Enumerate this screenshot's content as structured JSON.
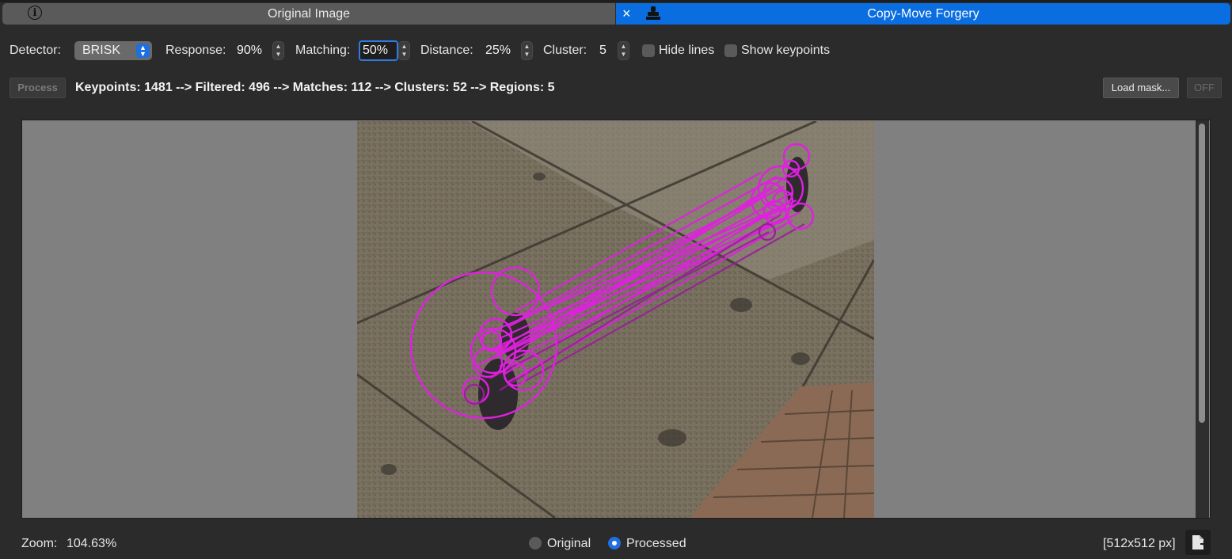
{
  "tabs": [
    {
      "label": "Original Image",
      "icon": "info-icon",
      "active": false
    },
    {
      "label": "Copy-Move Forgery",
      "icon": "stamp-icon",
      "active": true,
      "close_label": "×"
    }
  ],
  "controls": {
    "detector_label": "Detector:",
    "detector_value": "BRISK",
    "response_label": "Response:",
    "response_value": "90%",
    "matching_label": "Matching:",
    "matching_value": "50%",
    "distance_label": "Distance:",
    "distance_value": "25%",
    "cluster_label": "Cluster:",
    "cluster_value": "5",
    "hide_lines_label": "Hide lines",
    "hide_lines_checked": false,
    "show_keypoints_label": "Show keypoints",
    "show_keypoints_checked": false
  },
  "actions": {
    "process_label": "Process",
    "status_text": "Keypoints: 1481 --> Filtered: 496 --> Matches: 112 --> Clusters: 52 --> Regions: 5",
    "load_mask_label": "Load mask...",
    "off_label": "OFF"
  },
  "footer": {
    "zoom_label": "Zoom:",
    "zoom_value": "104.63%",
    "radio_original_label": "Original",
    "radio_processed_label": "Processed",
    "selected_view": "Processed",
    "image_size": "[512x512 px]"
  },
  "colors": {
    "accent": "#0a6ee0",
    "match_lines": "#e020e0",
    "background": "#2b2b2b",
    "viewer_bg": "#808080"
  }
}
